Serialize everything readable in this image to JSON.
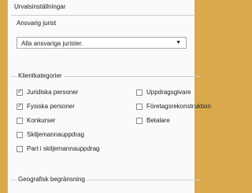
{
  "window_title": "Urvalsinställningar",
  "responsible_lawyer": {
    "label": "Ansvarig jurist",
    "selected": "Alla ansvariga jurister."
  },
  "client_categories": {
    "title": "Klientkategorier",
    "left_items": [
      {
        "label": "Juridiska personer",
        "checked": true
      },
      {
        "label": "Fysiska personer",
        "checked": true
      },
      {
        "label": "Konkurser",
        "checked": false
      },
      {
        "label": "Skiljemannauppdrag",
        "checked": false
      },
      {
        "label": "Part i skiljemannauppdrag",
        "checked": false
      }
    ],
    "right_items": [
      {
        "label": "Uppdragsgivare",
        "checked": false
      },
      {
        "label": "Företagsrekonstruktion",
        "checked": false
      },
      {
        "label": "Betalare",
        "checked": false
      }
    ]
  },
  "geo_limit": {
    "title": "Geografisk begränsning"
  },
  "icons": {
    "combo_arrow": "chevron-down-icon",
    "check": "checkmark-icon"
  }
}
